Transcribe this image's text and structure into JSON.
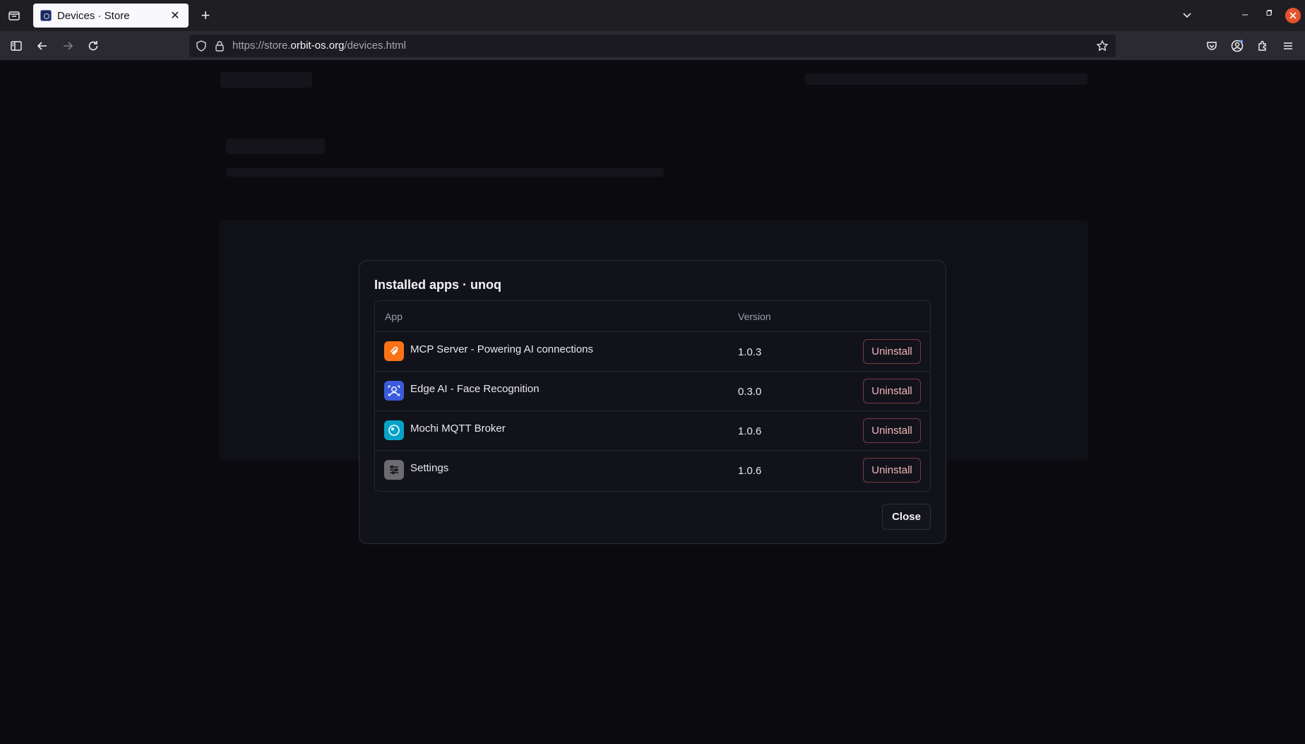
{
  "browser": {
    "tab_title": "Devices · Store",
    "tab_close": "✕",
    "new_tab": "+",
    "url_scheme": "https://store.",
    "url_host": "orbit-os.org",
    "url_path": "/devices.html"
  },
  "modal": {
    "title": "Installed apps · unoq",
    "columns": {
      "app": "App",
      "version": "Version"
    },
    "apps": [
      {
        "name": "MCP Server - Powering AI connections",
        "version": "1.0.3",
        "action": "Uninstall",
        "icon": "mcp-server-icon",
        "color": "#f97316"
      },
      {
        "name": "Edge AI - Face Recognition",
        "version": "0.3.0",
        "action": "Uninstall",
        "icon": "face-recognition-icon",
        "color": "#3b5bdb"
      },
      {
        "name": "Mochi MQTT Broker",
        "version": "1.0.6",
        "action": "Uninstall",
        "icon": "mqtt-broker-icon",
        "color": "#06a3c9"
      },
      {
        "name": "Settings",
        "version": "1.0.6",
        "action": "Uninstall",
        "icon": "settings-icon",
        "color": "#6b6b70"
      }
    ],
    "close_label": "Close"
  }
}
